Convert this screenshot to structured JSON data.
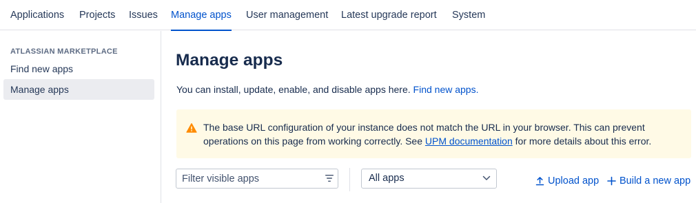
{
  "topnav": {
    "tabs": [
      {
        "label": "Applications"
      },
      {
        "label": "Projects"
      },
      {
        "label": "Issues"
      },
      {
        "label": "Manage apps"
      },
      {
        "label": "User management"
      },
      {
        "label": "Latest upgrade report"
      },
      {
        "label": "System"
      }
    ],
    "active_index": 3
  },
  "sidebar": {
    "heading": "ATLASSIAN MARKETPLACE",
    "items": [
      {
        "label": "Find new apps"
      },
      {
        "label": "Manage apps"
      }
    ],
    "selected_index": 1
  },
  "main": {
    "title": "Manage apps",
    "description": "You can install, update, enable, and disable apps here.",
    "description_link": "Find new apps.",
    "warning": {
      "icon": "warning-icon",
      "text_before": "The base URL configuration of your instance does not match the URL in your browser. This can prevent operations on this page from working correctly. See",
      "link": "UPM documentation",
      "text_after": "for more details about this error."
    },
    "filter": {
      "placeholder": "Filter visible apps",
      "value": ""
    },
    "app_type_select": {
      "value": "All apps"
    },
    "upload_label": "Upload app",
    "build_label": "Build a new app"
  },
  "colors": {
    "accent": "#0052cc",
    "text": "#172b4d",
    "warning_bg": "#fffae6",
    "warning_icon": "#ff8b00",
    "selected_bg": "#ebecf0"
  }
}
